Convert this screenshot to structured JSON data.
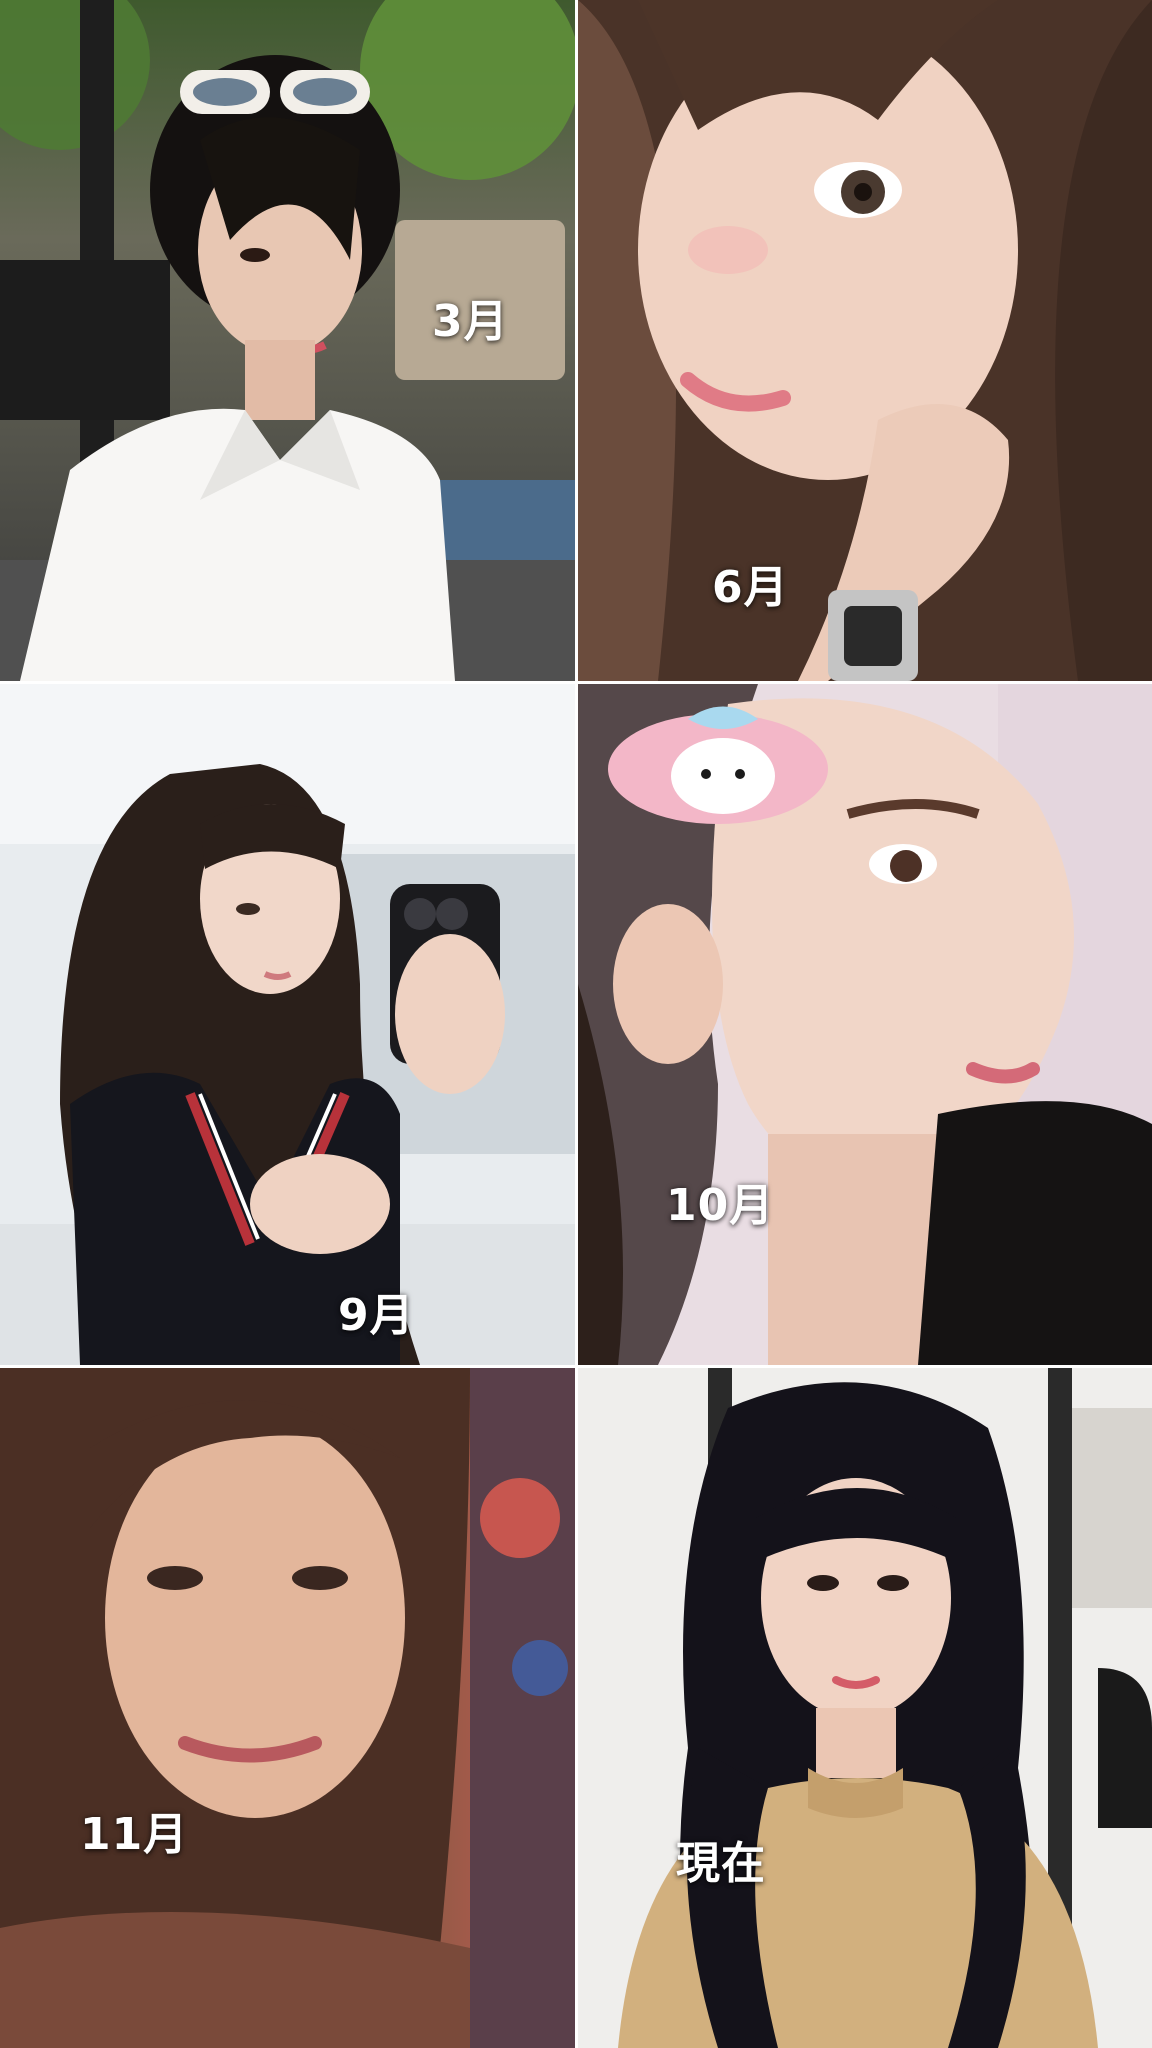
{
  "tiles": [
    {
      "label": "3月"
    },
    {
      "label": "6月"
    },
    {
      "label": "9月"
    },
    {
      "label": "10月"
    },
    {
      "label": "11月"
    },
    {
      "label": "現在"
    }
  ]
}
